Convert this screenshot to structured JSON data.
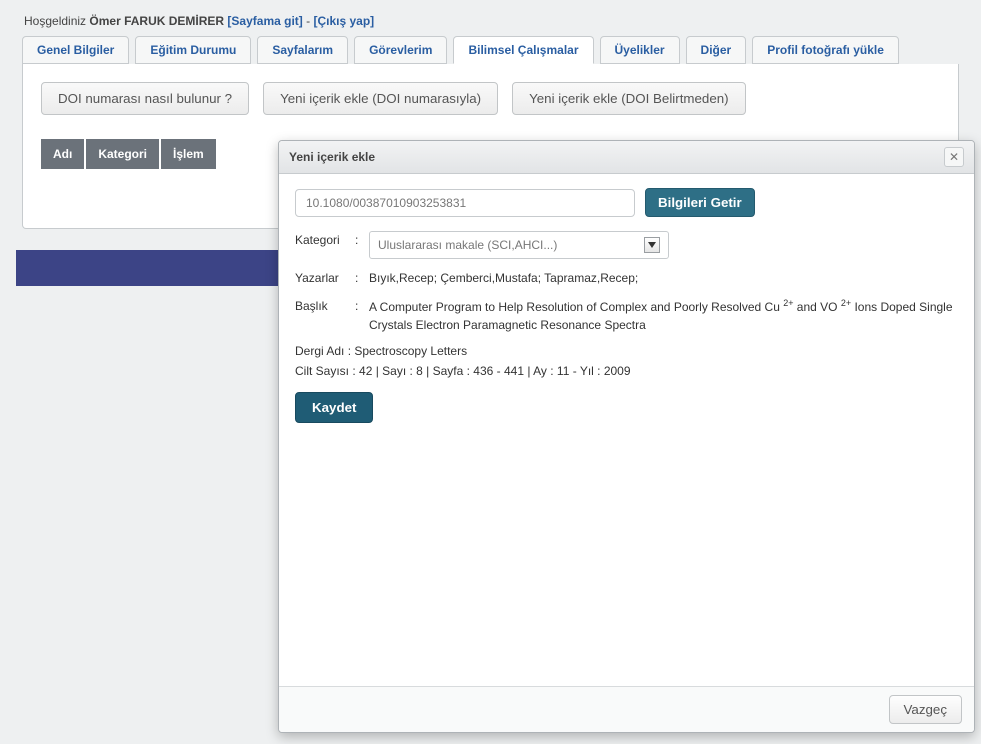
{
  "header": {
    "welcome": "Hoşgeldiniz",
    "user_name": "Ömer FARUK DEMİRER",
    "link_page": "[Sayfama git]",
    "dash": " - ",
    "link_logout": "[Çıkış yap]"
  },
  "tabs": [
    "Genel Bilgiler",
    "Eğitim Durumu",
    "Sayfalarım",
    "Görevlerim",
    "Bilimsel Çalışmalar",
    "Üyelikler",
    "Diğer",
    "Profil fotoğrafı yükle"
  ],
  "panel_buttons": {
    "doi_help": "DOI numarası nasıl bulunur ?",
    "new_doi": "Yeni içerik ekle (DOI numarasıyla)",
    "new_nodoi": "Yeni içerik ekle (DOI Belirtmeden)"
  },
  "table_headers": {
    "col1": "Adı",
    "col2": "Kategori",
    "col3": "İşlem"
  },
  "modal": {
    "title": "Yeni içerik ekle",
    "doi_value": "10.1080/00387010903253831",
    "fetch_btn": "Bilgileri Getir",
    "labels": {
      "kategori": "Kategori",
      "yazarlar": "Yazarlar",
      "baslik": "Başlık",
      "dergi": "Dergi Adı",
      "cilt_line": "Cilt Sayısı : 42 | Sayı : 8 | Sayfa : 436 - 441 | Ay : 11 - Yıl : 2009"
    },
    "kategori_value": "Uluslararası makale (SCI,AHCI...)",
    "yazarlar_value": "Bıyık,Recep; Çemberci,Mustafa; Tapramaz,Recep;",
    "baslik_value_prefix": "A Computer Program to Help Resolution of Complex and Poorly Resolved Cu ",
    "baslik_sup1": "2+",
    "baslik_mid": " and VO ",
    "baslik_sup2": "2+",
    "baslik_suffix": " Ions Doped Single Crystals Electron Paramagnetic Resonance Spectra",
    "dergi_value": "Spectroscopy Letters",
    "save_btn": "Kaydet",
    "cancel_btn": "Vazgeç"
  }
}
